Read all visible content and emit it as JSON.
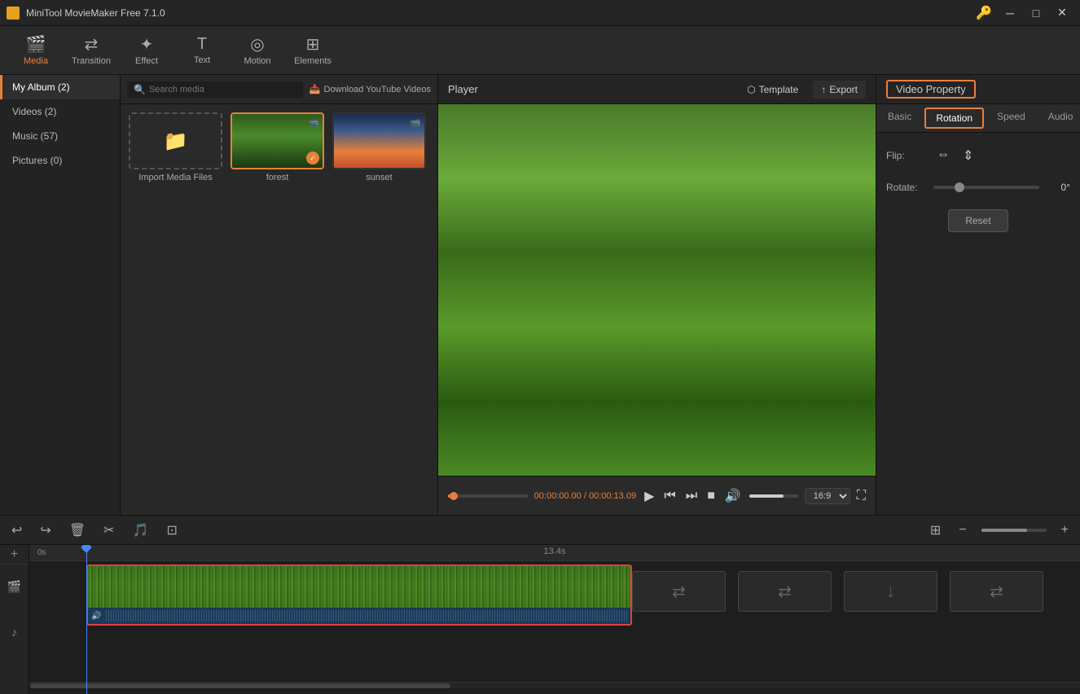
{
  "app": {
    "title": "MiniTool MovieMaker Free 7.1.0"
  },
  "titlebar": {
    "title": "MiniTool MovieMaker Free 7.1.0"
  },
  "toolbar": {
    "items": [
      {
        "id": "media",
        "label": "Media",
        "icon": "🎬",
        "active": true
      },
      {
        "id": "transition",
        "label": "Transition",
        "icon": "⇄"
      },
      {
        "id": "effect",
        "label": "Effect",
        "icon": "✦"
      },
      {
        "id": "text",
        "label": "Text",
        "icon": "T"
      },
      {
        "id": "motion",
        "label": "Motion",
        "icon": "◎"
      },
      {
        "id": "elements",
        "label": "Elements",
        "icon": "⊞"
      }
    ]
  },
  "sidebar": {
    "items": [
      {
        "label": "My Album (2)",
        "active": true
      },
      {
        "label": "Videos (2)"
      },
      {
        "label": "Music (57)"
      },
      {
        "label": "Pictures (0)"
      }
    ]
  },
  "media_panel": {
    "search_placeholder": "Search media",
    "download_label": "Download YouTube Videos",
    "import_label": "Import Media Files",
    "items": [
      {
        "id": "forest",
        "label": "forest",
        "type": "video",
        "selected": true
      },
      {
        "id": "sunset",
        "label": "sunset",
        "type": "video",
        "selected": false
      }
    ]
  },
  "player": {
    "label": "Player",
    "template_label": "Template",
    "export_label": "Export",
    "current_time": "00:00:00.00",
    "total_time": "00:00:13.09",
    "ratio": "16:9"
  },
  "right_panel": {
    "title": "Video Property",
    "tabs": [
      {
        "id": "basic",
        "label": "Basic"
      },
      {
        "id": "rotation",
        "label": "Rotation",
        "active": true
      },
      {
        "id": "speed",
        "label": "Speed"
      },
      {
        "id": "audio",
        "label": "Audio"
      }
    ],
    "flip_label": "Flip:",
    "rotate_label": "Rotate:",
    "rotate_value": "0°",
    "reset_label": "Reset"
  },
  "timeline": {
    "time_label": "13.4s",
    "toolbar": {
      "undo_label": "Undo",
      "redo_label": "Redo",
      "delete_label": "Delete",
      "cut_label": "Cut",
      "detach_label": "Detach audio",
      "crop_label": "Crop"
    }
  }
}
